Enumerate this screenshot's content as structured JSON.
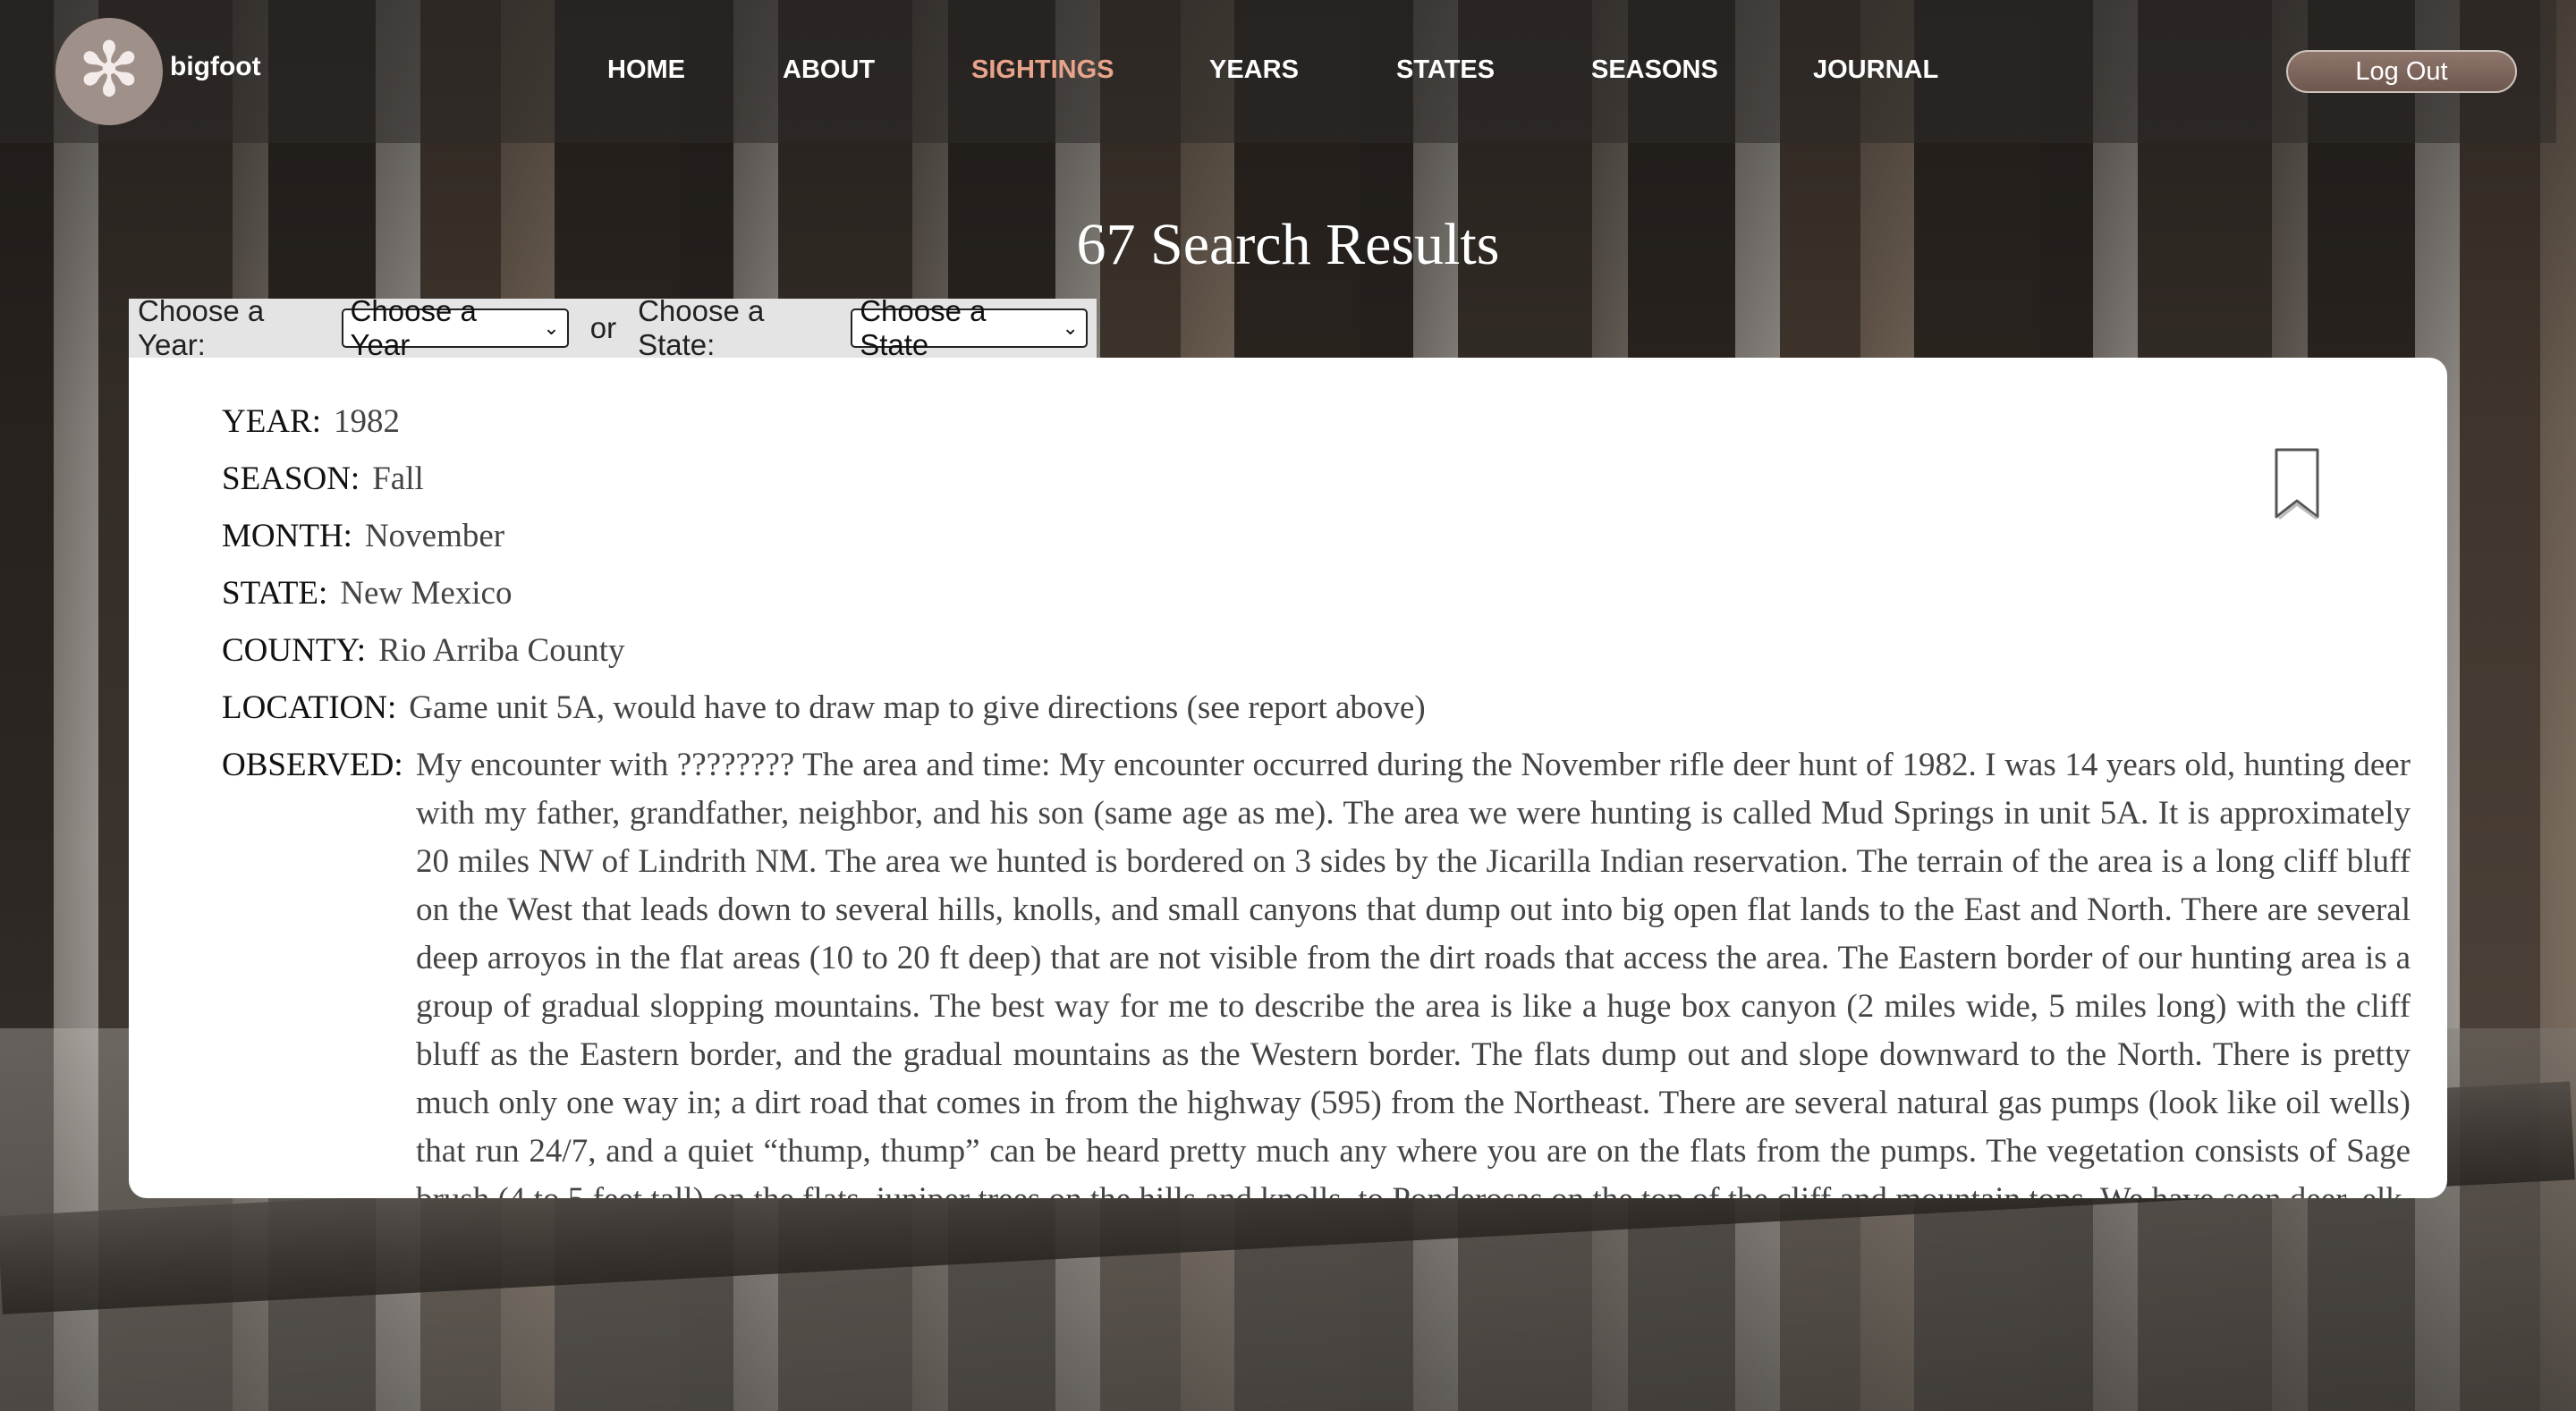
{
  "brand": {
    "name": "bigfoot",
    "logo_icon": "snowflake-star-icon"
  },
  "nav": {
    "items": [
      "HOME",
      "ABOUT",
      "SIGHTINGS",
      "YEARS",
      "STATES",
      "SEASONS",
      "JOURNAL"
    ],
    "active": "SIGHTINGS"
  },
  "logout_label": "Log Out",
  "results_title": "67 Search Results",
  "filters": {
    "year_label": "Choose a Year:",
    "year_value": "Choose a Year",
    "or": "or",
    "state_label": "Choose a State:",
    "state_value": "Choose a State"
  },
  "report": {
    "year_label": "YEAR:",
    "year": "1982",
    "season_label": "SEASON:",
    "season": "Fall",
    "month_label": "MONTH:",
    "month": "November",
    "state_label": "STATE:",
    "state": "New Mexico",
    "county_label": "COUNTY:",
    "county": "Rio Arriba County",
    "location_label": "LOCATION:",
    "location": "Game unit 5A, would have to draw map to give directions (see report above)",
    "observed_label": "OBSERVED:",
    "observed": "My encounter with ???????? The area and time: My encounter occurred during the November rifle deer hunt of 1982. I was 14 years old, hunting deer with my father, grandfather, neighbor, and his son (same age as me). The area we were hunting is called Mud Springs in unit 5A. It is approximately 20 miles NW of Lindrith NM. The area we hunted is bordered on 3 sides by the Jicarilla Indian reservation. The terrain of the area is a long cliff bluff on the West that leads down to several hills, knolls, and small canyons that dump out into big open flat lands to the East and North. There are several deep arroyos in the flat areas (10 to 20 ft deep) that are not visible from the dirt roads that access the area. The Eastern border of our hunting area is a group of gradual slopping mountains. The best way for me to describe the area is like a huge box canyon (2 miles wide, 5 miles long) with the cliff bluff as the Eastern border, and the gradual mountains as the Western border. The flats dump out and slope downward to the North. There is pretty much only one way in; a dirt road that comes in from the highway (595) from the Northeast. There are several natural gas pumps (look like oil wells) that run 24/7, and a quiet “thump, thump” can be heard pretty much any where you are on the flats from the pumps. The vegetation consists of Sage brush (4 to 5 feet tall) on the flats, juniper trees on the hills and knolls, to Ponderosas on the top of the cliff and mountain tops. We have seen deer, elk, bear, coyotes, squirrels, rabbits,"
  },
  "colors": {
    "active_nav": "#e8a48b",
    "logout_bg": "#7e665c",
    "card_bg": "#ffffff"
  }
}
